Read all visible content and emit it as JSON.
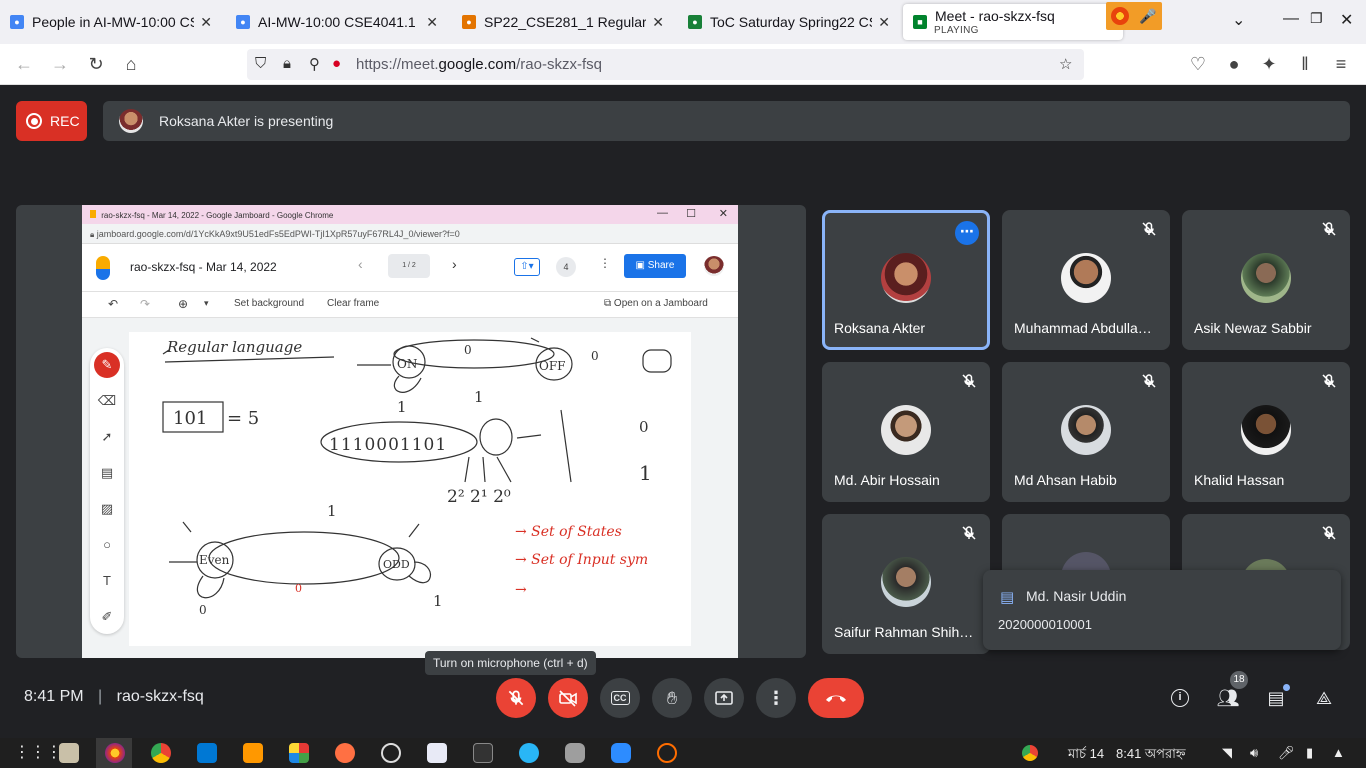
{
  "browser": {
    "tabs": [
      {
        "title": "People in AI-MW-10:00 CSE",
        "icon": "google-classroom-icon",
        "color": "#4285f4"
      },
      {
        "title": "AI-MW-10:00 CSE4041.1",
        "icon": "google-classroom-icon",
        "color": "#4285f4"
      },
      {
        "title": "SP22_CSE281_1 Regular",
        "icon": "google-classroom-icon",
        "color": "#e37400"
      },
      {
        "title": "ToC Saturday Spring22 CS",
        "icon": "google-classroom-icon",
        "color": "#188038"
      },
      {
        "title": "Meet - rao-skzx-fsq",
        "subtitle": "PLAYING",
        "icon": "google-meet-icon",
        "active": true
      }
    ],
    "url_prefix": "https://meet.",
    "url_domain": "google.com",
    "url_path": "/rao-skzx-fsq"
  },
  "meet": {
    "rec_label": "REC",
    "presenting_text": "Roksana Akter is presenting",
    "meeting_code": "rao-skzx-fsq",
    "time": "8:41 PM",
    "tooltip": "Turn on microphone (ctrl + d)",
    "people_count": "18",
    "participants": [
      {
        "name": "Roksana Akter",
        "speaking": true
      },
      {
        "name": "Muhammad Abdulla…",
        "muted": true
      },
      {
        "name": "Asik Newaz Sabbir",
        "muted": true
      },
      {
        "name": "Md. Abir Hossain",
        "muted": true
      },
      {
        "name": "Md Ahsan Habib",
        "muted": true
      },
      {
        "name": "Khalid Hassan",
        "muted": true
      },
      {
        "name": "Saifur Rahman Shih…",
        "muted": true
      }
    ],
    "chat_toast": {
      "sender": "Md. Nasir Uddin",
      "message": "2020000010001"
    }
  },
  "jamboard": {
    "window_title": "rao-skzx-fsq - Mar 14, 2022 - Google Jamboard - Google Chrome",
    "url": "jamboard.google.com/d/1YcKkA9xt9U51edFs5EdPWI-TjI1XpR57uyF67RL4J_0/viewer?f=0",
    "doc_title": "rao-skzx-fsq - Mar 14, 2022",
    "frame_indicator": "1 / 2",
    "viewers": "4",
    "share_label": "Share",
    "set_background": "Set background",
    "clear_frame": "Clear frame",
    "open_label": "Open on a Jamboard",
    "ink": {
      "regular_language": "Regular language",
      "on": "ON",
      "off": "OFF",
      "zero_a": "0",
      "zero_b": "0",
      "one_a": "1",
      "one_b": "1",
      "box_101": "101",
      "eq5": "= 5",
      "binary": "1110001101",
      "pow": "2²  2¹  2⁰",
      "even": "Even",
      "odd": "ODD",
      "one_c": "1",
      "one_d": "1",
      "zero_c": "0",
      "zero_d": "0",
      "arrow1": "→ Set of States",
      "arrow2": "→ Set of Input sym",
      "arrow3": "→",
      "right0": "0",
      "right1": "1"
    }
  },
  "taskbar": {
    "date": "মার্চ 14",
    "time": "8:41 অপরাহ্ন"
  }
}
